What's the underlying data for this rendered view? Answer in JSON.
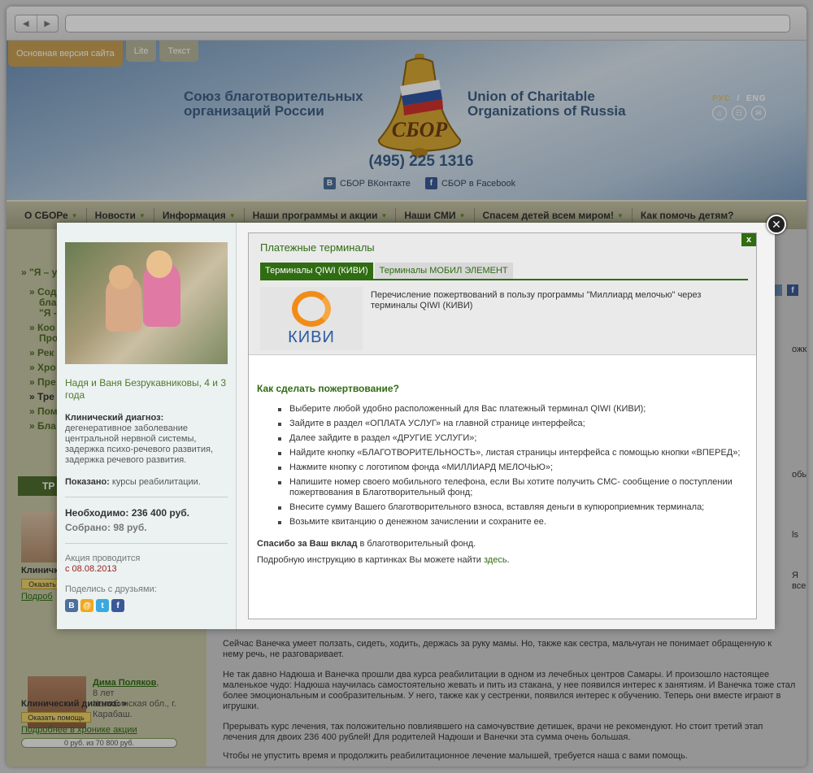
{
  "browser": {
    "back": "◀",
    "forward": "▶"
  },
  "header": {
    "version_tabs": [
      "Основная версия сайта",
      "Lite",
      "Текст"
    ],
    "org_ru": "Союз благотворительных организаций России",
    "org_en": "Union of Charitable Organizations of Russia",
    "logo_text": "СБОР",
    "phone": "(495) 225 1316",
    "vk_label": "СБОР ВКонтакте",
    "fb_label": "СБОР в Facebook",
    "lang_ru": "РУС",
    "lang_sep": "/",
    "lang_en": "ENG"
  },
  "menu": [
    "О СБОРе",
    "Новости",
    "Информация",
    "Наши программы и акции",
    "Наши СМИ",
    "Спасем детей всем миром!",
    "Как помочь детям?"
  ],
  "left_menu": [
    "» \"Я – у",
    "» Сод",
    "благ",
    "\"Я -",
    "» Коо",
    "Про",
    "» Рек",
    "» Хро",
    "» Пре",
    "» Тре",
    "» Пом",
    "» Бла"
  ],
  "modal": {
    "child_name": "Надя и Ваня Безрукавниковы, 4 и 3 года",
    "diagnosis_label": "Клинический диагноз:",
    "diagnosis_text": "дегенеративное заболевание центральной нервной системы, задержка психо-речевого развития, задержка речевого развития.",
    "shown_label": "Показано:",
    "shown_text": "курсы реабилитации.",
    "need": "Необходимо: 236 400 руб.",
    "collected": "Собрано: 98 руб.",
    "action_label": "Акция проводится",
    "action_date": "с 08.08.2013",
    "share_label": "Поделись с друзьями:",
    "terminal_title": "Платежные терминалы",
    "close_x": "x",
    "tab_qiwi": "Терминалы QIWI (КИВИ)",
    "tab_mobil": "Терминалы МОБИЛ ЭЛЕМЕНТ",
    "qiwi_logo": "КИВИ",
    "terminal_desc": "Перечисление пожертвований в пользу программы \"Миллиард мелочью\" через терминалы QIWI (КИВИ)",
    "howto_title": "Как сделать пожертвование?",
    "steps": [
      "Выберите любой удобно расположенный для Вас платежный терминал QIWI (КИВИ);",
      "Зайдите в раздел «ОПЛАТА УСЛУГ» на главной странице интерфейса;",
      "Далее зайдите в раздел «ДРУГИЕ УСЛУГИ»;",
      "Найдите кнопку «БЛАГОТВОРИТЕЛЬНОСТЬ», листая страницы интерфейса с помощью кнопки «ВПЕРЕД»;",
      "Нажмите кнопку с логотипом фонда «МИЛЛИАРД МЕЛОЧЬЮ»;",
      "Напишите номер своего мобильного телефона, если Вы хотите получить СМС- сообщение о поступлении пожертвования в Благотворительный фонд;",
      "Внесите сумму Вашего благотворительного взноса, вставляя деньги в купюроприемник терминала;",
      "Возьмите квитанцию о денежном зачислении и сохраните ее."
    ],
    "thanks_bold": "Спасибо за Ваш вклад",
    "thanks_rest": " в благотворительный фонд.",
    "instr_text": "Подробную инструкцию в картинках Вы можете найти ",
    "instr_link": "здесь",
    "instr_end": "."
  },
  "background": {
    "green_bar": "ТР",
    "para1": "Сейчас Ванечка умеет ползать, сидеть, ходить, держась за руку мамы. Но, также как сестра, мальчуган не понимает обращенную к нему речь, не разговаривает.",
    "para2": "Не так давно Надюша и Ванечка прошли два курса реабилитации в одном из лечебных центров Самары. И произошло настоящее маленькое чудо: Надюша научилась самостоятельно жевать и пить из стакана, у нее появился интерес к занятиям. И Ванечка тоже стал более эмоциональным и сообразительным. У него, также как у сестренки, появился интерес к обучению. Теперь они вместе играют в игрушки.",
    "para3": "Прерывать курс лечения, так положительно повлиявшего на самочувствие детишек, врачи не рекомендуют. Но стоит третий этап лечения для двоих 236 400 рублей! Для родителей Надюши и Ванечки эта сумма очень большая.",
    "para4": "Чтобы не упустить время и продолжить реабилитационное лечение малышей, требуется наша с вами помощь.",
    "frag_ozhka": "ожка",
    "frag_obyli": "обыли",
    "frag_ls": "ls",
    "frag_ya_vse": "Я все",
    "frag_klinich": "Клиничк",
    "frag_okaz": "Оказать",
    "frag_podr": "Подроб",
    "child2_name": "Дима Поляков",
    "child2_comma": ",",
    "child2_age": "8 лет",
    "child2_region": "Челябинская обл., г. Карабаш.",
    "child2_diag": "Клинический диагноз: »",
    "help_btn": "Оказать помощь",
    "more_link": "Подробнее в хронике акции",
    "progress": "0 руб. из 70 800 руб."
  },
  "colors": {
    "accent_green": "#2f6c12",
    "qiwi_orange": "#f28c18",
    "qiwi_blue": "#2b5aa0"
  }
}
